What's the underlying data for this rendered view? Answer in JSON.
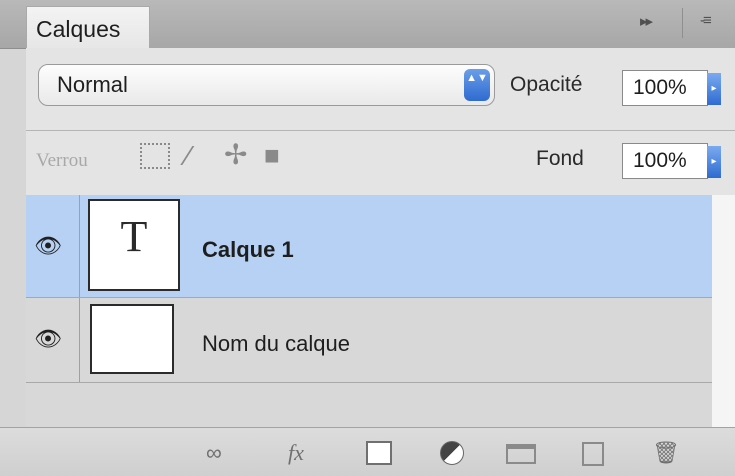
{
  "panel": {
    "tab_label": "Calques",
    "header_buttons": [
      "▸▸",
      "-≡"
    ]
  },
  "blend": {
    "mode": "Normal",
    "arrows": "▲▼"
  },
  "opacity": {
    "label": "Opacité",
    "value": "100%"
  },
  "lock": {
    "label": "Verrou",
    "icons": [
      "lock-transparent-icon",
      "lock-paint-icon",
      "lock-position-icon",
      "lock-all-icon"
    ]
  },
  "fill": {
    "label": "Fond",
    "value": "100%"
  },
  "layers": [
    {
      "name": "Calque 1",
      "thumb": "T",
      "selected": true,
      "visible": true
    },
    {
      "name": "Nom du calque",
      "thumb": "",
      "selected": false,
      "visible": true
    }
  ],
  "footer_icons": [
    "link-layers-icon",
    "fx-icon",
    "add-mask-icon",
    "adjustment-layer-icon",
    "new-group-icon",
    "new-layer-icon",
    "trash-icon"
  ],
  "footer_glyphs": {
    "link": "∞",
    "fx": "fx",
    "trash": "🗑"
  },
  "colors": {
    "selection": "#b6d1f3",
    "accent": "#2f6bd0"
  }
}
